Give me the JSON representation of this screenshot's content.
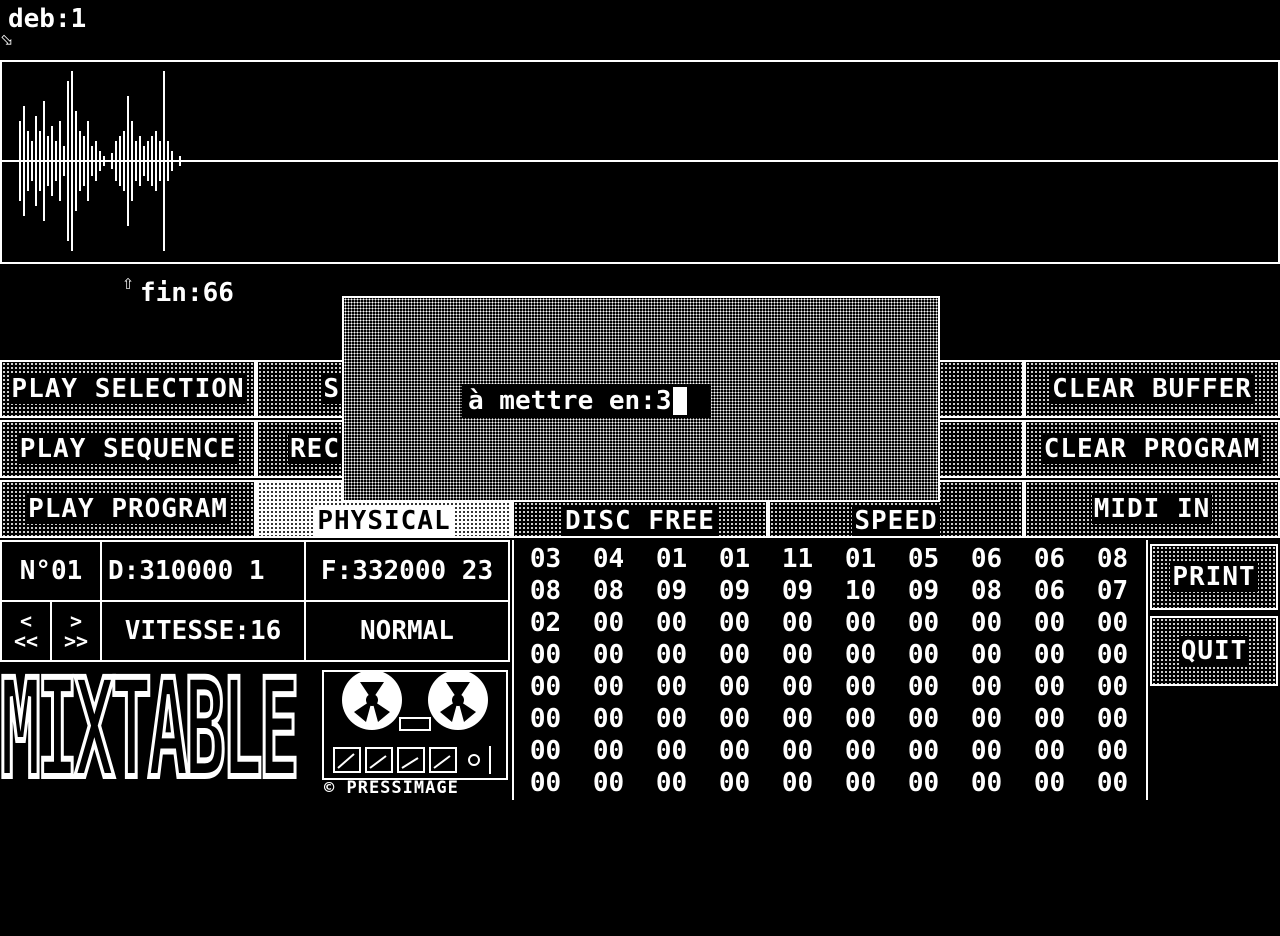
{
  "markers": {
    "start": "deb:1",
    "end": "fin:66"
  },
  "buttons": {
    "play_selection": "PLAY SELECTION",
    "play_sequence": "PLAY SEQUENCE",
    "play_program": "PLAY PROGRAM",
    "s_partial": "S",
    "rec_partial": "REC",
    "physical": "PHYSICAL",
    "disc_free": "DISC FREE",
    "speed": "SPEED",
    "clear_buffer": "CLEAR BUFFER",
    "clear_program": "CLEAR PROGRAM",
    "midi_in": "MIDI IN",
    "print": "PRINT",
    "quit": "QUIT"
  },
  "info": {
    "number": "N°01",
    "start_pos": "D:310000 1",
    "end_pos": "F:332000 23",
    "prev": "<",
    "prev_fast": "<<",
    "next": ">",
    "next_fast": ">>",
    "speed": "VITESSE:16",
    "mode": "NORMAL"
  },
  "logo": {
    "title": "MIXTABLE",
    "copyright": "© PRESSIMAGE"
  },
  "dialog": {
    "prompt": "à mettre en:",
    "value": "3"
  },
  "sequence_grid": [
    [
      "03",
      "04",
      "01",
      "01",
      "11",
      "01",
      "05",
      "06",
      "06",
      "08"
    ],
    [
      "08",
      "08",
      "09",
      "09",
      "09",
      "10",
      "09",
      "08",
      "06",
      "07"
    ],
    [
      "02",
      "00",
      "00",
      "00",
      "00",
      "00",
      "00",
      "00",
      "00",
      "00"
    ],
    [
      "00",
      "00",
      "00",
      "00",
      "00",
      "00",
      "00",
      "00",
      "00",
      "00"
    ],
    [
      "00",
      "00",
      "00",
      "00",
      "00",
      "00",
      "00",
      "00",
      "00",
      "00"
    ],
    [
      "00",
      "00",
      "00",
      "00",
      "00",
      "00",
      "00",
      "00",
      "00",
      "00"
    ],
    [
      "00",
      "00",
      "00",
      "00",
      "00",
      "00",
      "00",
      "00",
      "00",
      "00"
    ],
    [
      "00",
      "00",
      "00",
      "00",
      "00",
      "00",
      "00",
      "00",
      "00",
      "00"
    ]
  ]
}
